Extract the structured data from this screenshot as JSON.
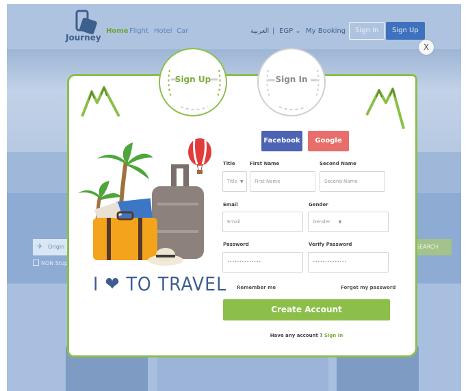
{
  "background": {
    "logo_text": "Journey",
    "nav": [
      "Home",
      "Flight",
      "Hotel",
      "Car"
    ],
    "language": "العربية",
    "currency": "EGP",
    "my_booking": "My Booking",
    "sign_in": "Sign In",
    "sign_up": "Sign Up",
    "origin_placeholder": "Origin",
    "non_stop": "NON Stop",
    "search": "SEARCH"
  },
  "modal": {
    "close_label": "X",
    "tabs": {
      "sign_up": "Sign Up",
      "sign_in": "Sign In"
    },
    "tagline": {
      "left": "I",
      "right": "TO TRAVEL"
    },
    "social": {
      "facebook": "Facebook",
      "google": "Google"
    },
    "form": {
      "title_label": "Title",
      "title_value": "Title",
      "first_name_label": "First Name",
      "first_name_placeholder": "First Name",
      "second_name_label": "Second Name",
      "second_name_placeholder": "Second Name",
      "email_label": "Email",
      "email_placeholder": "Email",
      "gender_label": "Gender",
      "gender_value": "Gender",
      "password_label": "Password",
      "password_placeholder": "••••••••••••••",
      "verify_password_label": "Verify Password",
      "verify_password_placeholder": "••••••••••••••",
      "remember_me": "Remember me",
      "forget_password": "Forget my password",
      "create_account": "Create Account",
      "have_account": "Have any account ?",
      "sign_in_link": "Sign In"
    }
  },
  "colors": {
    "accent_green": "#8cbf4a",
    "facebook_blue": "#4d63b3",
    "google_red": "#e76e6a",
    "brand_blue": "#3e5e91"
  }
}
